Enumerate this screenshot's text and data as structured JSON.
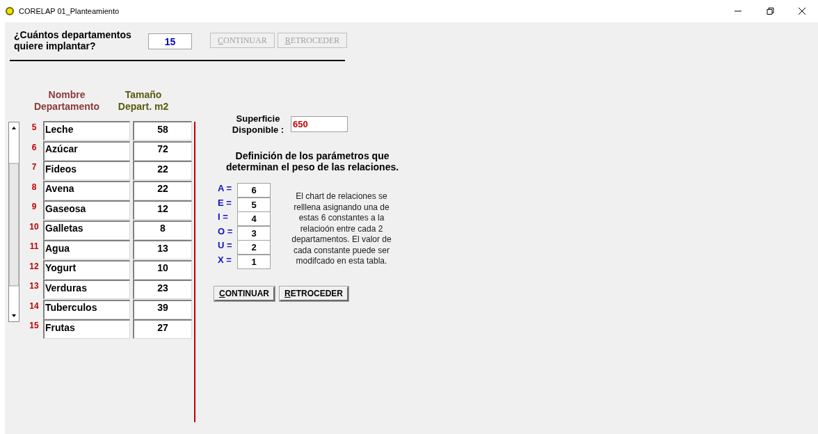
{
  "window": {
    "title": "CORELAP 01_Planteamiento"
  },
  "question": {
    "label": "¿Cuántos departamentos quiere implantar?",
    "value": "15"
  },
  "top_buttons": [
    {
      "label": "CONTINUAR",
      "disabled": true
    },
    {
      "label": "RETROCEDER",
      "disabled": true
    }
  ],
  "table": {
    "columns": [
      "Nombre Departamento",
      "Tamaño Depart. m2"
    ],
    "rows": [
      {
        "number": "5",
        "name": "Leche",
        "size": "58"
      },
      {
        "number": "6",
        "name": "Azúcar",
        "size": "72"
      },
      {
        "number": "7",
        "name": "Fideos",
        "size": "22"
      },
      {
        "number": "8",
        "name": "Avena",
        "size": "22"
      },
      {
        "number": "9",
        "name": "Gaseosa",
        "size": "12"
      },
      {
        "number": "10",
        "name": "Galletas",
        "size": "8"
      },
      {
        "number": "11",
        "name": "Agua",
        "size": "13"
      },
      {
        "number": "12",
        "name": "Yogurt",
        "size": "10"
      },
      {
        "number": "13",
        "name": "Verduras",
        "size": "23"
      },
      {
        "number": "14",
        "name": "Tuberculos",
        "size": "39"
      },
      {
        "number": "15",
        "name": "Frutas",
        "size": "27"
      }
    ]
  },
  "surface": {
    "label": "Superficie Disponible :",
    "value": "650"
  },
  "parameters": {
    "heading": "Definición de los parámetros que determinan el peso de las relaciones.",
    "items": [
      {
        "label": "A =",
        "value": "6"
      },
      {
        "label": "E =",
        "value": "5"
      },
      {
        "label": "I =",
        "value": "4"
      },
      {
        "label": "O =",
        "value": "3"
      },
      {
        "label": "U =",
        "value": "2"
      },
      {
        "label": "X =",
        "value": "1"
      }
    ],
    "description": "El chart de relaciones se relllena asignando una de estas 6 constantes a la relacioón entre cada 2 departamentos. El valor de cada constante puede ser modifcado en esta tabla."
  },
  "bottom_buttons": [
    {
      "label": "CONTINUAR",
      "disabled": false
    },
    {
      "label": "RETROCEDER",
      "disabled": false
    }
  ]
}
